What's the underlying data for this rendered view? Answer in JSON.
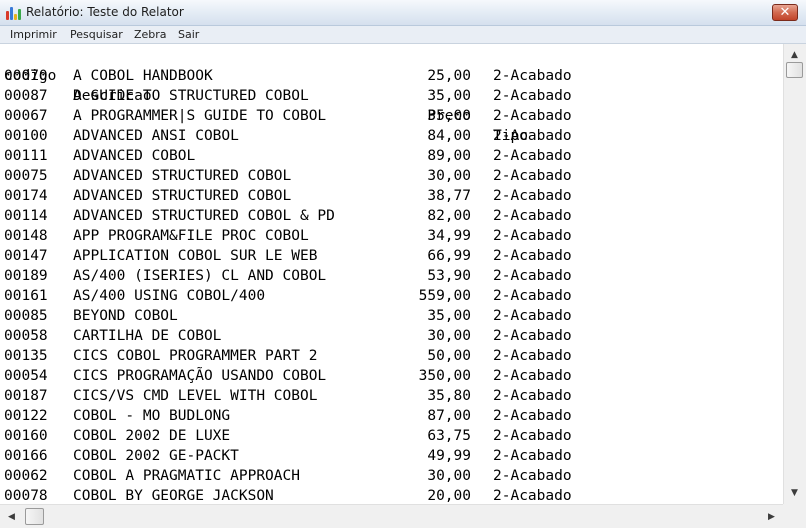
{
  "window": {
    "title": "Relatório: Teste do Relator",
    "close_label": "✕"
  },
  "menu": [
    "Imprimir",
    "Pesquisar",
    "Zebra",
    "Sair"
  ],
  "report": {
    "headers": {
      "codigo": "codigo",
      "descricao": "Descricao",
      "preco": "Preco",
      "tipo": "Tipo"
    },
    "rows": [
      [
        "00070",
        "A COBOL HANDBOOK",
        "25,00",
        "2-Acabado"
      ],
      [
        "00087",
        "A GUIDE TO STRUCTURED COBOL",
        "35,00",
        "2-Acabado"
      ],
      [
        "00067",
        "A PROGRAMMER|S GUIDE TO COBOL",
        "35,00",
        "2-Acabado"
      ],
      [
        "00100",
        "ADVANCED ANSI COBOL",
        "84,00",
        "2-Acabado"
      ],
      [
        "00111",
        "ADVANCED COBOL",
        "89,00",
        "2-Acabado"
      ],
      [
        "00075",
        "ADVANCED STRUCTURED COBOL",
        "30,00",
        "2-Acabado"
      ],
      [
        "00174",
        "ADVANCED STRUCTURED COBOL",
        "38,77",
        "2-Acabado"
      ],
      [
        "00114",
        "ADVANCED STRUCTURED COBOL & PD",
        "82,00",
        "2-Acabado"
      ],
      [
        "00148",
        "APP PROGRAM&FILE PROC COBOL",
        "34,99",
        "2-Acabado"
      ],
      [
        "00147",
        "APPLICATION COBOL SUR LE WEB",
        "66,99",
        "2-Acabado"
      ],
      [
        "00189",
        "AS/400 (ISERIES) CL AND COBOL",
        "53,90",
        "2-Acabado"
      ],
      [
        "00161",
        "AS/400 USING COBOL/400",
        "559,00",
        "2-Acabado"
      ],
      [
        "00085",
        "BEYOND COBOL",
        "35,00",
        "2-Acabado"
      ],
      [
        "00058",
        "CARTILHA DE COBOL",
        "30,00",
        "2-Acabado"
      ],
      [
        "00135",
        "CICS COBOL PROGRAMMER PART 2",
        "50,00",
        "2-Acabado"
      ],
      [
        "00054",
        "CICS PROGRAMAÇÃO USANDO COBOL",
        "350,00",
        "2-Acabado"
      ],
      [
        "00187",
        "CICS/VS CMD LEVEL WITH COBOL",
        "35,80",
        "2-Acabado"
      ],
      [
        "00122",
        "COBOL - MO BUDLONG",
        "87,00",
        "2-Acabado"
      ],
      [
        "00160",
        "COBOL 2002 DE LUXE",
        "63,75",
        "2-Acabado"
      ],
      [
        "00166",
        "COBOL 2002 GE-PACKT",
        "49,99",
        "2-Acabado"
      ],
      [
        "00062",
        "COBOL A PRAGMATIC APPROACH",
        "30,00",
        "2-Acabado"
      ],
      [
        "00078",
        "COBOL BY GEORGE JACKSON",
        "20,00",
        "2-Acabado"
      ]
    ]
  },
  "icons": {
    "app": "bar-chart-icon",
    "scroll_up": "triangle-up-icon",
    "scroll_down": "triangle-down-icon",
    "scroll_left": "triangle-left-icon",
    "scroll_right": "triangle-right-icon"
  },
  "colors": {
    "close_button": "#c74a30",
    "titlebar": "#dfe8f3",
    "menubar": "#e9eef5"
  }
}
